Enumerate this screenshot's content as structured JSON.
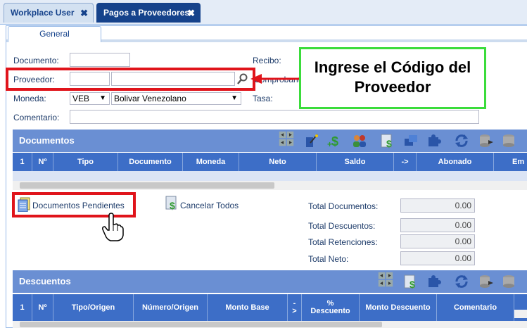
{
  "tabs": [
    {
      "label": "Workplace User",
      "close": "✖"
    },
    {
      "label": "Pagos a Proveedores",
      "close": "✖"
    }
  ],
  "form_tab": "General",
  "fields": {
    "documento_label": "Documento:",
    "proveedor_label": "Proveedor:",
    "moneda_label": "Moneda:",
    "moneda_code": "VEB",
    "moneda_name": "Bolivar Venezolano",
    "comentario_label": "Comentario:",
    "recibo_label": "Recibo:",
    "comprobante_label": "Comprobante:",
    "tasa_label": "Tasa:"
  },
  "callout": {
    "line1": "Ingrese el Código del",
    "line2": "Proveedor"
  },
  "documentos": {
    "title": "Documentos",
    "columns": [
      "1",
      "Nº",
      "Tipo",
      "Documento",
      "Moneda",
      "Neto",
      "Saldo",
      "->",
      "Abonado",
      "Em"
    ]
  },
  "actions": {
    "pendientes": "Documentos Pendientes",
    "cancelar": "Cancelar Todos"
  },
  "totals": [
    {
      "label": "Total Documentos:",
      "value": "0.00"
    },
    {
      "label": "Total Descuentos:",
      "value": "0.00"
    },
    {
      "label": "Total Retenciones:",
      "value": "0.00"
    },
    {
      "label": "Total Neto:",
      "value": "0.00"
    }
  ],
  "descuentos": {
    "title": "Descuentos",
    "columns": [
      "1",
      "Nº",
      "Tipo/Origen",
      "Número/Origen",
      "Monto Base",
      "- >",
      "% Descuento",
      "Monto Descuento",
      "Comentario"
    ]
  },
  "colors": {
    "highlight": "#e0141b",
    "callout_border": "#3bdc3b",
    "grid_title": "#6a8fd3",
    "grid_header": "#3d6ec7"
  }
}
